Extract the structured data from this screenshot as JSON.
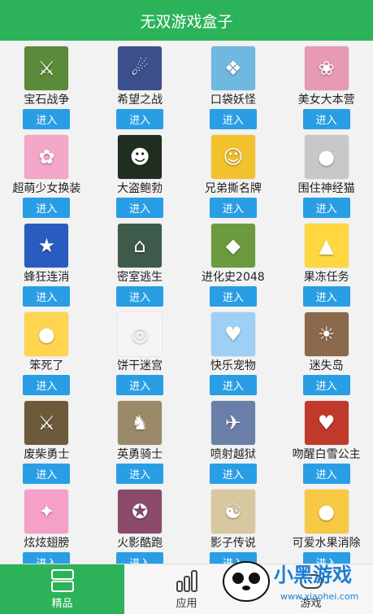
{
  "header": {
    "title": "无双游戏盒子"
  },
  "colors": {
    "header": "#2cb35a",
    "button": "#2a9ee4"
  },
  "games": [
    {
      "name": "宝石战争",
      "button": "进入",
      "icon": "gem-war-thumb",
      "bg": "#5a8a3a",
      "glyph": "⚔"
    },
    {
      "name": "希望之战",
      "button": "进入",
      "icon": "hope-war-thumb",
      "bg": "#3b4f8c",
      "glyph": "☄"
    },
    {
      "name": "口袋妖怪",
      "button": "进入",
      "icon": "pocket-monster-thumb",
      "bg": "#6fb8e0",
      "glyph": "❖"
    },
    {
      "name": "美女大本营",
      "button": "进入",
      "icon": "beauty-camp-thumb",
      "bg": "#e79ab4",
      "glyph": "❀"
    },
    {
      "name": "超萌少女换装",
      "button": "进入",
      "icon": "dressup-girl-thumb",
      "bg": "#f3a6c8",
      "glyph": "✿"
    },
    {
      "name": "大盗鲍勃",
      "button": "进入",
      "icon": "robber-bob-thumb",
      "bg": "#1f2e1f",
      "glyph": "☻"
    },
    {
      "name": "兄弟撕名牌",
      "button": "进入",
      "icon": "name-tag-thumb",
      "bg": "#f2c12e",
      "glyph": "☺"
    },
    {
      "name": "围住神经猫",
      "button": "进入",
      "icon": "circle-cat-thumb",
      "bg": "#c8c8c8",
      "glyph": "●"
    },
    {
      "name": "蜂狂连消",
      "button": "进入",
      "icon": "bee-match-thumb",
      "bg": "#2a5bbf",
      "glyph": "★"
    },
    {
      "name": "密室逃生",
      "button": "进入",
      "icon": "room-escape-thumb",
      "bg": "#3d5a4a",
      "glyph": "⌂"
    },
    {
      "name": "进化史2048",
      "button": "进入",
      "icon": "evolution-2048-thumb",
      "bg": "#6b9a3f",
      "glyph": "◆"
    },
    {
      "name": "果冻任务",
      "button": "进入",
      "icon": "jelly-quest-thumb",
      "bg": "#ffd740",
      "glyph": "▲"
    },
    {
      "name": "笨死了",
      "button": "进入",
      "icon": "dumb-ways-thumb",
      "bg": "#ffd54f",
      "glyph": "●"
    },
    {
      "name": "饼干迷宫",
      "button": "进入",
      "icon": "cookie-maze-thumb",
      "bg": "#f5f5f5",
      "glyph": "◎"
    },
    {
      "name": "快乐宠物",
      "button": "进入",
      "icon": "happy-pets-thumb",
      "bg": "#9ed0f5",
      "glyph": "♥"
    },
    {
      "name": "迷失岛",
      "button": "进入",
      "icon": "lost-island-thumb",
      "bg": "#8a6a4a",
      "glyph": "☀"
    },
    {
      "name": "废柴勇士",
      "button": "进入",
      "icon": "loser-warrior-thumb",
      "bg": "#6d5a3a",
      "glyph": "⚔"
    },
    {
      "name": "英勇骑士",
      "button": "进入",
      "icon": "brave-knight-thumb",
      "bg": "#9a8a6a",
      "glyph": "♞"
    },
    {
      "name": "喷射越狱",
      "button": "进入",
      "icon": "jet-escape-thumb",
      "bg": "#6a7fa8",
      "glyph": "✈"
    },
    {
      "name": "吻醒白雪公主",
      "button": "进入",
      "icon": "snow-white-thumb",
      "bg": "#c0392b",
      "glyph": "♥"
    },
    {
      "name": "炫炫翅膀",
      "button": "进入",
      "icon": "cool-wings-thumb",
      "bg": "#f4a0c8",
      "glyph": "✦"
    },
    {
      "name": "火影酷跑",
      "button": "进入",
      "icon": "naruto-run-thumb",
      "bg": "#8a4a6a",
      "glyph": "✪"
    },
    {
      "name": "影子传说",
      "button": "进入",
      "icon": "shadow-legend-thumb",
      "bg": "#d8c8a0",
      "glyph": "☯"
    },
    {
      "name": "可爱水果消除",
      "button": "进入",
      "icon": "fruit-match-thumb",
      "bg": "#f6c844",
      "glyph": "●"
    }
  ],
  "tabs": [
    {
      "label": "精品",
      "icon": "featured-icon",
      "active": true
    },
    {
      "label": "应用",
      "icon": "apps-chart-icon",
      "active": false
    },
    {
      "label": "游戏",
      "icon": "games-icon",
      "active": false
    }
  ],
  "watermark": {
    "brand": "小黑游戏",
    "url": "www.xiaohei.com"
  }
}
